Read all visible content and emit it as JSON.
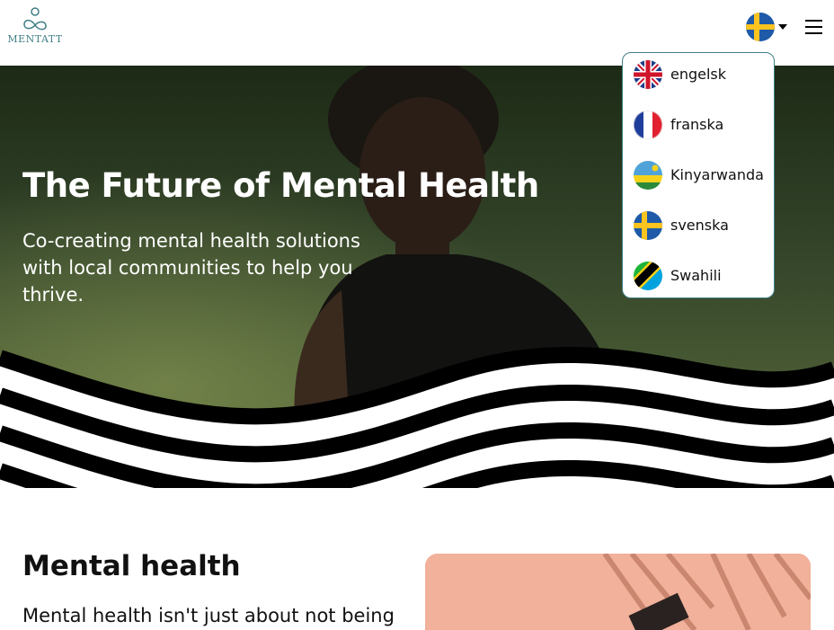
{
  "header": {
    "logo_text": "MENTATT",
    "selected_language": "svenska",
    "menu_icon": "hamburger-menu-icon"
  },
  "hero": {
    "title": "The Future of Mental Health",
    "subtitle": "Co-creating mental health solutions with local communities to help you thrive."
  },
  "language_menu": {
    "items": [
      {
        "label": "engelsk",
        "flag": "uk-flag-icon"
      },
      {
        "label": "franska",
        "flag": "france-flag-icon"
      },
      {
        "label": "Kinyarwanda",
        "flag": "rwanda-flag-icon"
      },
      {
        "label": "svenska",
        "flag": "sweden-flag-icon"
      },
      {
        "label": "Swahili",
        "flag": "tanzania-flag-icon"
      }
    ]
  },
  "section": {
    "title": "Mental health",
    "text": "Mental health isn't just about not being"
  },
  "colors": {
    "brand_teal": "#3f7f86",
    "hero_text": "#ffffff",
    "wave_black": "#000000"
  }
}
